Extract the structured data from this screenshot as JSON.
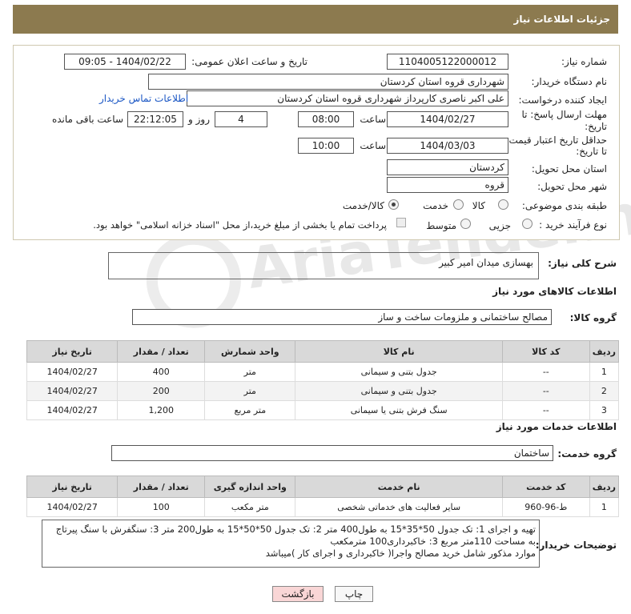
{
  "header": {
    "title": "جزئیات اطلاعات نیاز"
  },
  "form": {
    "need_number_label": "شماره نیاز:",
    "need_number": "1104005122000012",
    "announce_label": "تاریخ و ساعت اعلان عمومی:",
    "announce_value": "1404/02/22 - 09:05",
    "buyer_org_label": "نام دستگاه خریدار:",
    "buyer_org": "شهرداری قروه استان کردستان",
    "creator_label": "ایجاد کننده درخواست:",
    "creator": "علی اکبر ناصری کارپرداز شهرداری قروه استان کردستان",
    "contact_link": "اطلاعات تماس خریدار",
    "deadline_label_1": "مهلت ارسال پاسخ: تا",
    "deadline_label_2": "تاریخ:",
    "deadline_date": "1404/02/27",
    "time_label": "ساعت",
    "deadline_time": "08:00",
    "days": "4",
    "days_label": "روز و",
    "remaining_time": "22:12:05",
    "remaining_label": "ساعت باقی مانده",
    "validity_label_1": "حداقل تاریخ اعتبار قیمت:",
    "validity_label_2": "تا تاریخ:",
    "validity_date": "1404/03/03",
    "validity_time": "10:00",
    "province_label": "استان محل تحویل:",
    "province": "کردستان",
    "city_label": "شهر محل تحویل:",
    "city": "قروه",
    "category_label": "طبقه بندی موضوعی:",
    "category_options": [
      "کالا",
      "خدمت",
      "کالا/خدمت"
    ],
    "process_label": "نوع فرآیند خرید :",
    "process_options": [
      "جزیی",
      "متوسط"
    ],
    "payment_note": "پرداخت تمام یا بخشی از مبلغ خرید،از محل \"اسناد خزانه اسلامی\" خواهد بود."
  },
  "description": {
    "label": "شرح کلی نیاز:",
    "value": "بهسازی میدان امیر کبیر"
  },
  "goods": {
    "section_title": "اطلاعات کالاهای مورد نیاز",
    "group_label": "گروه کالا:",
    "group_value": "مصالح ساختمانی و ملزومات ساخت و ساز",
    "columns": [
      "ردیف",
      "کد کالا",
      "نام کالا",
      "واحد شمارش",
      "تعداد / مقدار",
      "تاریخ نیاز"
    ],
    "rows": [
      [
        "1",
        "--",
        "جدول بتنی و سیمانی",
        "متر",
        "400",
        "1404/02/27"
      ],
      [
        "2",
        "--",
        "جدول بتنی و سیمانی",
        "متر",
        "200",
        "1404/02/27"
      ],
      [
        "3",
        "--",
        "سنگ فرش بتنی یا سیمانی",
        "متر مربع",
        "1,200",
        "1404/02/27"
      ]
    ]
  },
  "services": {
    "section_title": "اطلاعات خدمات مورد نیاز",
    "group_label": "گروه خدمت:",
    "group_value": "ساختمان",
    "columns": [
      "ردیف",
      "کد خدمت",
      "نام خدمت",
      "واحد اندازه گیری",
      "تعداد / مقدار",
      "تاریخ نیاز"
    ],
    "rows": [
      [
        "1",
        "ط-96-960",
        "سایر فعالیت های خدماتی شخصی",
        "متر مکعب",
        "100",
        "1404/02/27"
      ]
    ]
  },
  "buyer_notes": {
    "label": "توضیحات خریدار:",
    "line1": "تهیه و اجرای 1: تک جدول 50*35*15 به طول400 متر  2: تک جدول 50*50*15 به طول200 متر  3: سنگفرش با سنگ پیرتاج",
    "line2": "به مساحت 110متر مربع 3: خاکبرداری100 مترمکعب",
    "line3": "موارد مذکور شامل خرید مصالح واجرا( خاکبرداری و اجرای کار )میباشد"
  },
  "buttons": {
    "print": "چاپ",
    "back": "بازگشت"
  },
  "colors": {
    "header": "#8c7a4f",
    "back_button": "#f9d6d6",
    "link": "#1a56c4"
  }
}
